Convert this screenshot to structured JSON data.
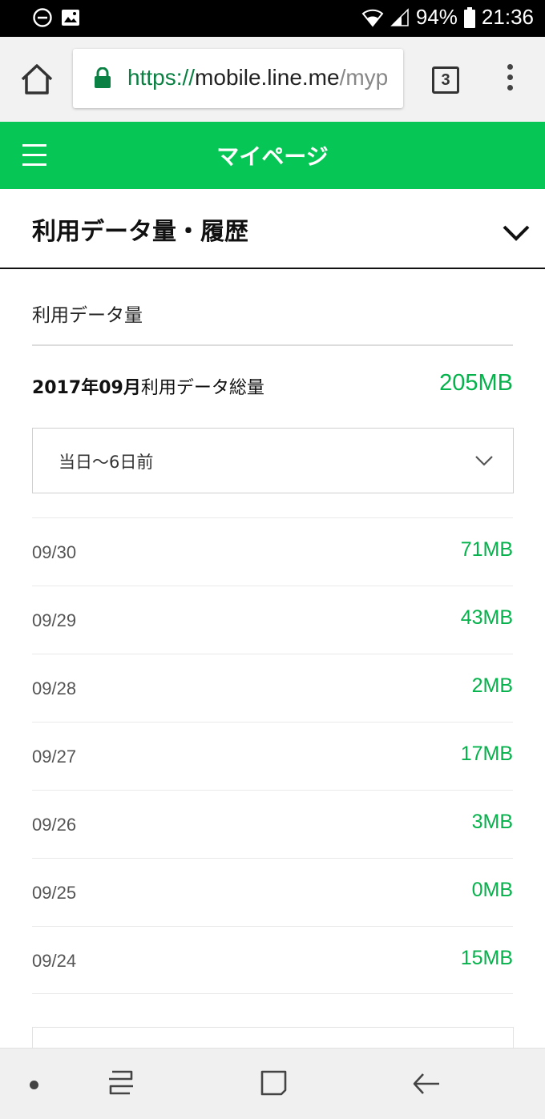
{
  "status_bar": {
    "battery": "94%",
    "time": "21:36",
    "icons": [
      "do-not-disturb-icon",
      "image-icon",
      "wifi-icon",
      "signal-icon",
      "battery-icon"
    ]
  },
  "browser": {
    "url_scheme": "https://",
    "url_host": "mobile.line.me",
    "url_path": "/myp",
    "tab_count": "3"
  },
  "header": {
    "title": "マイページ"
  },
  "section": {
    "title": "利用データ量・履歴",
    "subtitle": "利用データ量"
  },
  "total": {
    "month": "2017年09月",
    "label": "利用データ総量",
    "value": "205MB"
  },
  "range_select": {
    "selected": "当日〜6日前"
  },
  "usage": [
    {
      "date": "09/30",
      "amount": "71MB"
    },
    {
      "date": "09/29",
      "amount": "43MB"
    },
    {
      "date": "09/28",
      "amount": "2MB"
    },
    {
      "date": "09/27",
      "amount": "17MB"
    },
    {
      "date": "09/26",
      "amount": "3MB"
    },
    {
      "date": "09/25",
      "amount": "0MB"
    },
    {
      "date": "09/24",
      "amount": "15MB"
    }
  ],
  "colors": {
    "brand_green": "#06c755",
    "value_green": "#06b24b",
    "secure_green": "#0b8043"
  }
}
